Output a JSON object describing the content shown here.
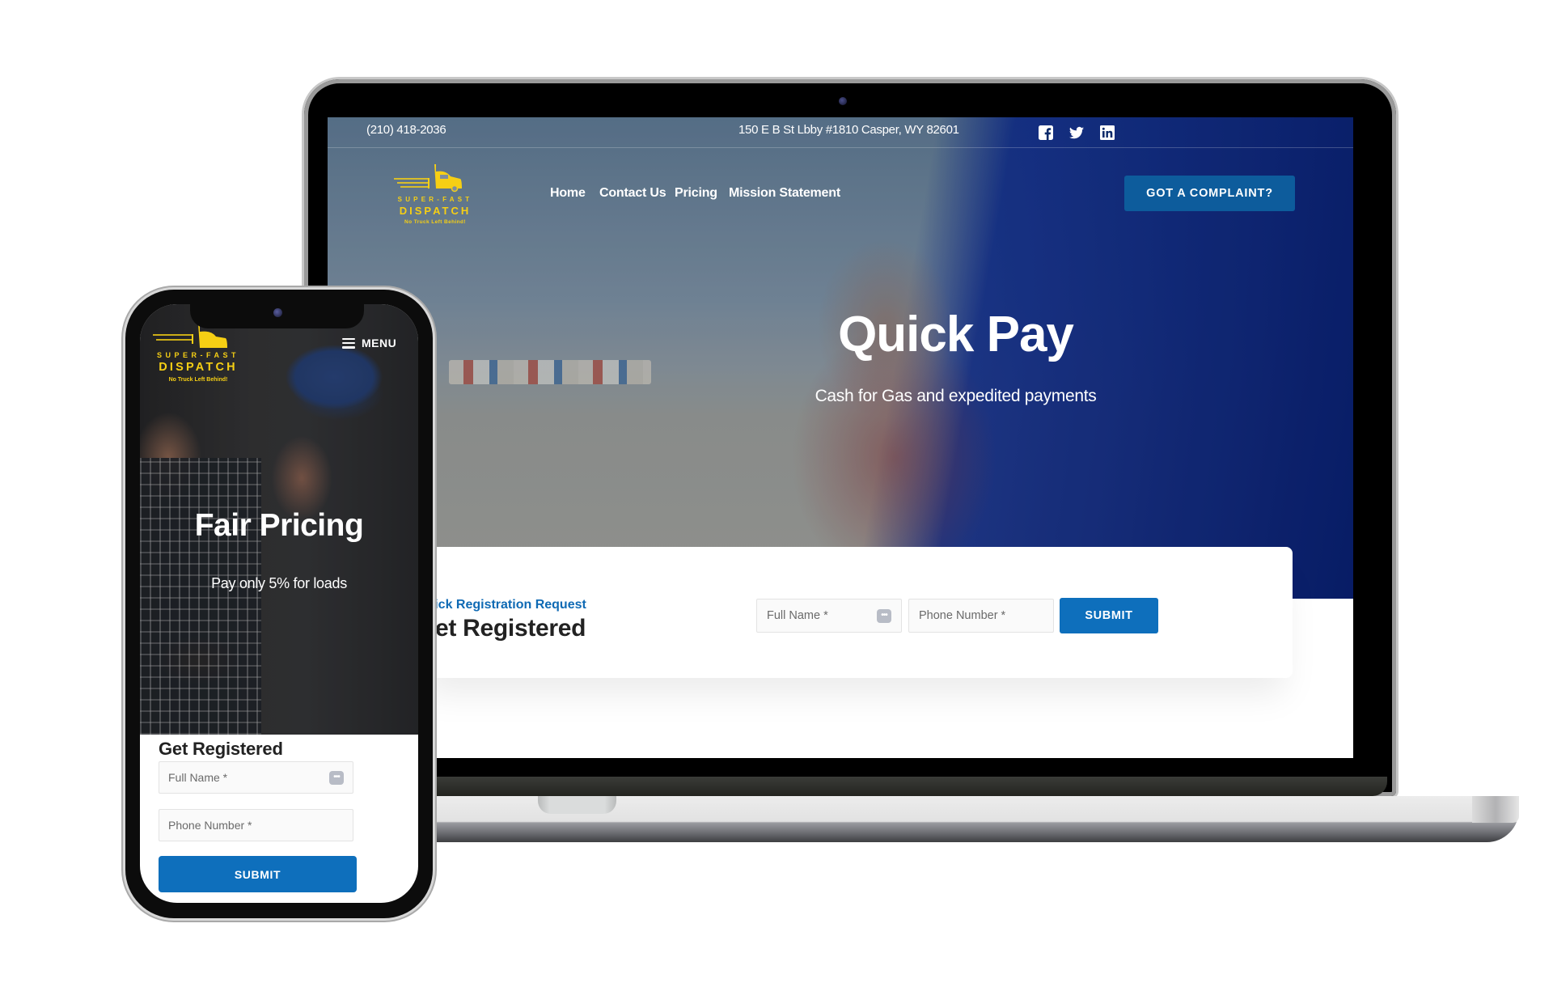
{
  "desktop": {
    "topbar": {
      "phone": "(210) 418-2036",
      "address": "150 E B St Lbby #1810 Casper, WY 82601",
      "social": [
        {
          "name": "facebook-icon"
        },
        {
          "name": "twitter-icon"
        },
        {
          "name": "linkedin-icon"
        }
      ]
    },
    "logo": {
      "line1": "SUPER-FAST",
      "line2": "DISPATCH",
      "tagline": "No Truck Left Behind!"
    },
    "nav": [
      {
        "label": "Home"
      },
      {
        "label": "Contact Us"
      },
      {
        "label": "Pricing"
      },
      {
        "label": "Mission Statement"
      }
    ],
    "cta_button": "GOT A COMPLAINT?",
    "hero": {
      "title": "Quick Pay",
      "subtitle": "Cash for Gas and expedited payments"
    },
    "registration": {
      "kicker": "Quick Registration Request",
      "title": "Get Registered",
      "full_name_placeholder": "Full Name *",
      "phone_placeholder": "Phone Number *",
      "submit_label": "SUBMIT"
    }
  },
  "mobile": {
    "logo": {
      "line1": "SUPER-FAST",
      "line2": "DISPATCH",
      "tagline": "No Truck Left Behind!"
    },
    "menu_label": "MENU",
    "hero": {
      "title": "Fair Pricing",
      "subtitle": "Pay only 5% for loads"
    },
    "registration": {
      "title": "Get Registered",
      "full_name_placeholder": "Full Name *",
      "phone_placeholder": "Phone Number *",
      "submit_label": "SUBMIT"
    }
  },
  "colors": {
    "brand_yellow": "#f6cf14",
    "primary_blue": "#0e6fbc",
    "cta_blue": "#0d5c9c",
    "kicker_blue": "#0f6ab4"
  }
}
